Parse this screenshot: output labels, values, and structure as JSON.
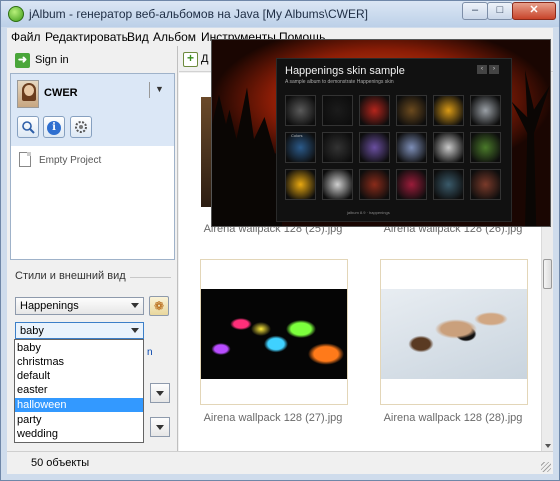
{
  "window": {
    "title": "jAlbum - генератор веб-альбомов на Java [My Albums\\CWER]",
    "controls": {
      "minimize": "–",
      "maximize": "□",
      "close": "✕"
    }
  },
  "menubar": {
    "items": [
      "Файл",
      "Редактировать",
      "Вид",
      "Альбом",
      "Инструменты",
      "Помощь"
    ]
  },
  "sidebar": {
    "sign_in": "Sign in",
    "user_name": "CWER",
    "empty_project": "Empty Project",
    "styles_section": "Стили и внешний вид",
    "skin": "Happenings",
    "style": "baby",
    "style_options": [
      "baby",
      "christmas",
      "default",
      "easter",
      "halloween",
      "party",
      "wedding"
    ],
    "highlighted_option": "halloween"
  },
  "toolbar": {
    "add_label": "Д"
  },
  "gallery": {
    "items": [
      {
        "caption": "Airena wallpack 128 (25).jpg"
      },
      {
        "caption": "Airena wallpack 128 (26).jpg"
      },
      {
        "caption": "Airena wallpack 128 (27).jpg"
      },
      {
        "caption": "Airena wallpack 128 (28).jpg"
      }
    ]
  },
  "preview": {
    "title": "Happenings skin sample",
    "subtitle": "A sample album to demonstrate Happenings skin",
    "first_tile_label": "Colors",
    "footer": "jalbum 8.9 · happenings",
    "nav_prev": "‹",
    "nav_next": "›",
    "tile_colors": [
      "#5a5a5a",
      "#1b1b1b",
      "#b4251c",
      "#6b4a1e",
      "#d99a16",
      "#9aa0a6",
      "#2b5a8a",
      "#333333",
      "#6a4fa0",
      "#7e8fb8",
      "#c9c9c9",
      "#4a7a2a",
      "#e8a810",
      "#cfcfcf",
      "#8a2b1a",
      "#9b1c3a",
      "#3a5a6a",
      "#7a3a2a"
    ]
  },
  "status": {
    "text": "50 объекты"
  }
}
